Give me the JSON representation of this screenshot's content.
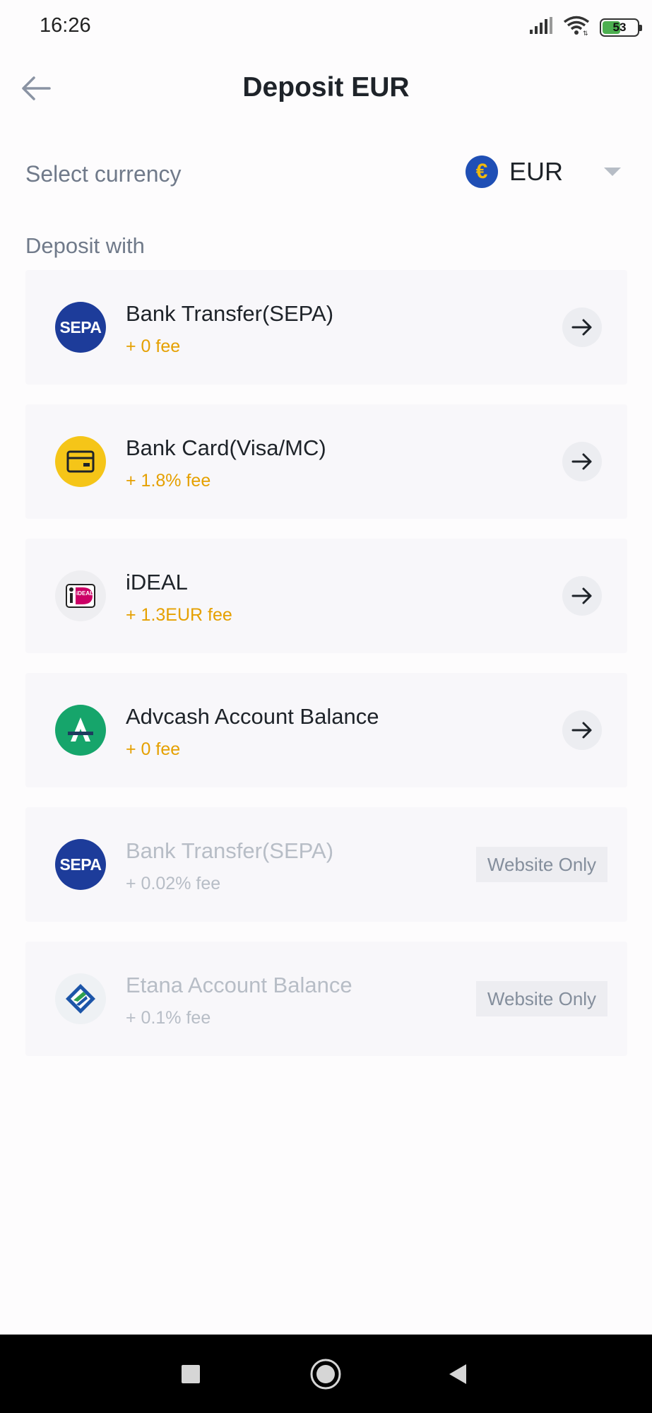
{
  "status_bar": {
    "time": "16:26",
    "battery_level": "53",
    "battery_fraction": 0.53,
    "battery_color": "#4CAF50"
  },
  "header": {
    "title": "Deposit EUR",
    "back_icon": "arrow-left-icon"
  },
  "currency": {
    "label": "Select currency",
    "selected": "EUR",
    "coin_symbol": "€",
    "dropdown_icon": "caret-down-icon"
  },
  "deposit_section": {
    "label": "Deposit with",
    "methods": [
      {
        "name": "Bank Transfer(SEPA)",
        "fee": "+ 0 fee",
        "icon": "sepa-icon",
        "icon_text": "SEPA",
        "enabled": true
      },
      {
        "name": "Bank Card(Visa/MC)",
        "fee": "+ 1.8% fee",
        "icon": "bank-card-icon",
        "enabled": true
      },
      {
        "name": "iDEAL",
        "fee": "+ 1.3EUR fee",
        "icon": "ideal-icon",
        "icon_text": "iDEAL",
        "enabled": true
      },
      {
        "name": "Advcash Account Balance",
        "fee": "+ 0 fee",
        "icon": "advcash-icon",
        "enabled": true
      },
      {
        "name": "Bank Transfer(SEPA)",
        "fee": "+ 0.02% fee",
        "icon": "sepa-icon",
        "icon_text": "SEPA",
        "enabled": false,
        "badge": "Website Only"
      },
      {
        "name": "Etana Account Balance",
        "fee": "+ 0.1% fee",
        "icon": "etana-icon",
        "enabled": false,
        "badge": "Website Only"
      }
    ]
  },
  "colors": {
    "fee_accent": "#E5A000",
    "title_text": "#1E2329",
    "secondary_text": "#707A8A",
    "disabled_text": "#B7BDC6"
  },
  "nav_bar": {
    "buttons": [
      "recent-apps-square-icon",
      "home-circle-icon",
      "back-triangle-icon"
    ]
  }
}
